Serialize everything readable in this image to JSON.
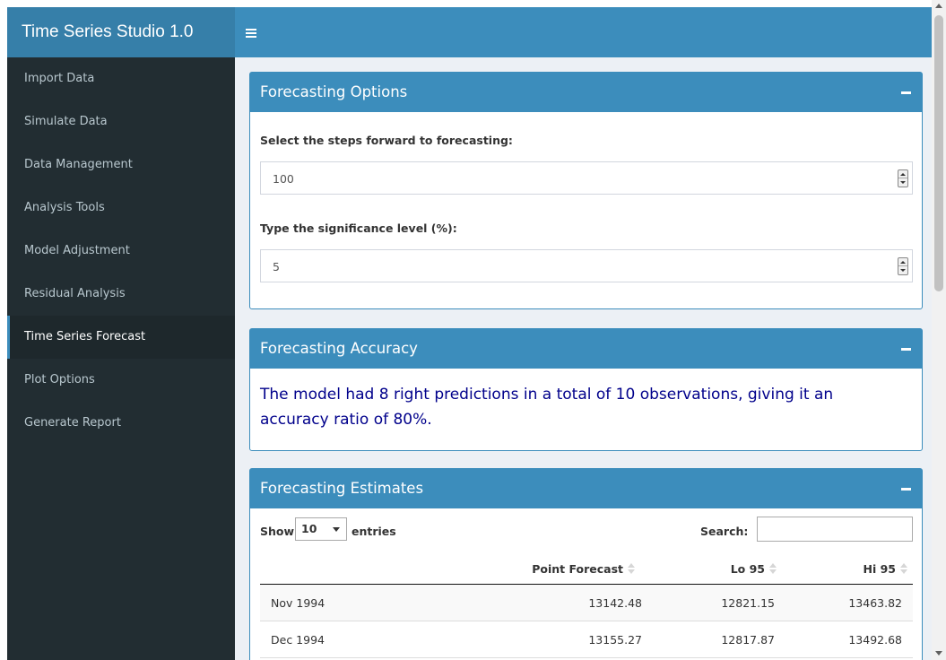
{
  "header": {
    "app_title": "Time Series Studio 1.0",
    "toggle_icon": "hamburger-menu-icon"
  },
  "sidebar": {
    "items": [
      {
        "label": "Import Data"
      },
      {
        "label": "Simulate Data"
      },
      {
        "label": "Data Management"
      },
      {
        "label": "Analysis Tools"
      },
      {
        "label": "Model Adjustment"
      },
      {
        "label": "Residual Analysis"
      },
      {
        "label": "Time Series Forecast",
        "active": true
      },
      {
        "label": "Plot Options"
      },
      {
        "label": "Generate Report"
      }
    ]
  },
  "forecasting_options": {
    "title": "Forecasting Options",
    "steps_label": "Select the steps forward to forecasting:",
    "steps_value": "100",
    "significance_label": "Type the significance level (%):",
    "significance_value": "5"
  },
  "forecasting_accuracy": {
    "title": "Forecasting Accuracy",
    "text": "The model had 8 right predictions in a total of 10 observations, giving it an accuracy ratio of 80%."
  },
  "forecasting_estimates": {
    "title": "Forecasting Estimates",
    "show_label": "Show",
    "length_value": "10",
    "entries_label": "entries",
    "search_label": "Search:",
    "search_value": "",
    "columns": [
      "",
      "Point Forecast",
      "Lo 95",
      "Hi 95"
    ],
    "rows": [
      {
        "date": "Nov 1994",
        "point": "13142.48",
        "lo": "12821.15",
        "hi": "13463.82"
      },
      {
        "date": "Dec 1994",
        "point": "13155.27",
        "lo": "12817.87",
        "hi": "13492.68"
      }
    ]
  },
  "colors": {
    "header": "#3c8dbc",
    "logo": "#367fa9",
    "sidebar": "#222d32",
    "sidebar_active": "#1e282c",
    "content_bg": "#ecf0f5",
    "accuracy_text": "#00008b"
  }
}
